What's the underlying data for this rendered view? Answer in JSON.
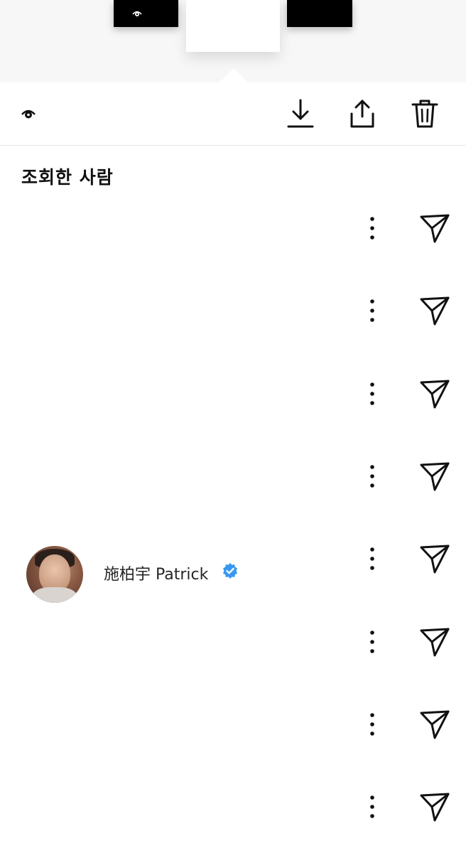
{
  "toolbar": {
    "icons": [
      "eye-icon",
      "download-icon",
      "share-icon",
      "trash-icon"
    ]
  },
  "viewers_section": {
    "title": "조회한 사람"
  },
  "viewers": [
    {
      "name": "",
      "verified": false
    },
    {
      "name": "",
      "verified": false
    },
    {
      "name": "",
      "verified": false
    },
    {
      "name": "",
      "verified": false
    },
    {
      "name": "施柏宇 Patrick",
      "verified": true
    },
    {
      "name": "",
      "verified": false
    },
    {
      "name": "",
      "verified": false
    },
    {
      "name": "",
      "verified": false
    }
  ],
  "colors": {
    "verified_badge": "#3897f0",
    "top_background": "#f7f7f7"
  }
}
